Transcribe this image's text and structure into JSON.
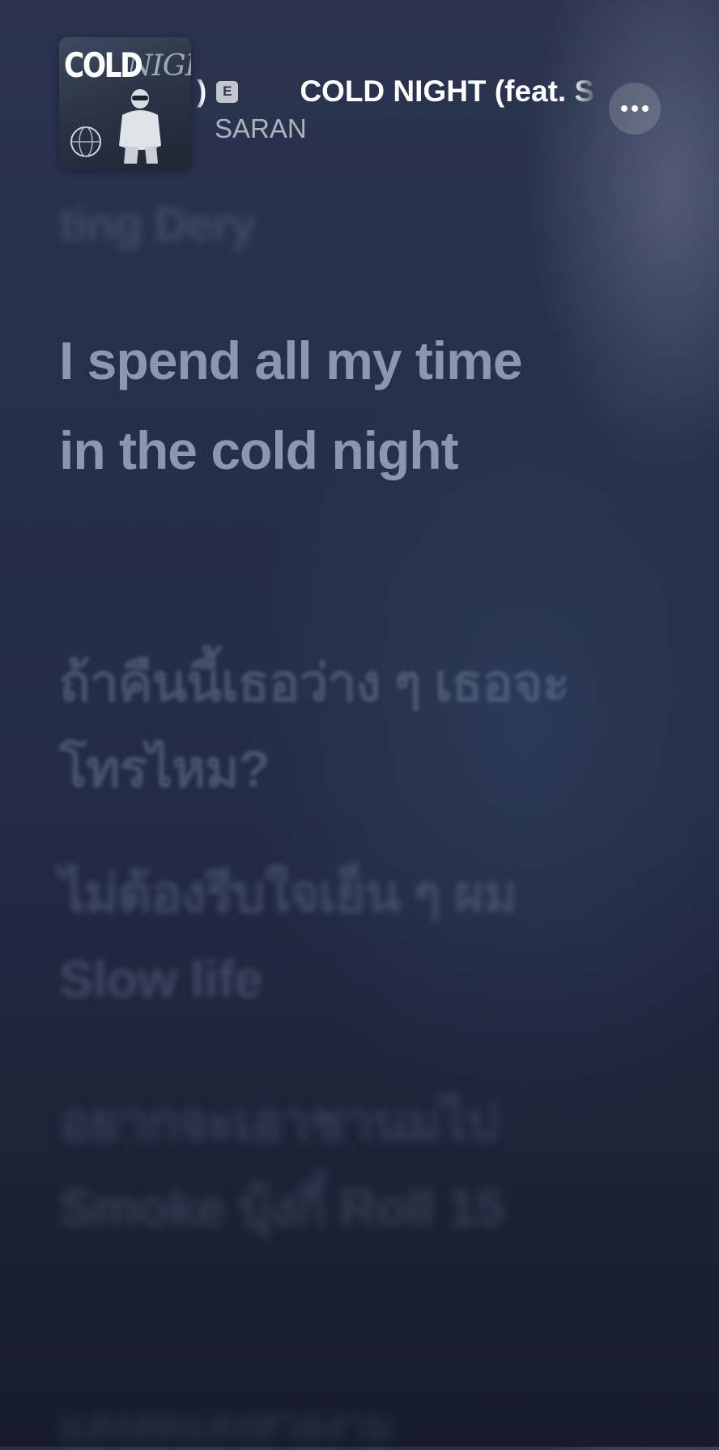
{
  "track": {
    "title": "COLD NIGHT (feat. S",
    "title_tail": ")",
    "explicit_label": "E",
    "artist": "SARAN"
  },
  "artwork": {
    "word_left": "COLD",
    "word_right": "NIGHT"
  },
  "menu": {
    "more_icon": "ellipsis-icon"
  },
  "lyrics": {
    "previous": "ting Dery",
    "current": "I spend all my time in the cold night",
    "next": [
      "ถ้าคืนนี้เธอว่าง ๆ เธอจะโทรไหม?",
      "ไม่ต้องรีบใจเย็น ๆ ผม Slow life",
      "อยากจะเอาชานมไป Smoke บุ้งกี๋ Roll 15",
      "แสงสดแสงสวยงาม"
    ]
  },
  "colors": {
    "background_top": "#2a3450",
    "background_bottom": "#161c2c",
    "current_lyric": "#8b97b1"
  }
}
